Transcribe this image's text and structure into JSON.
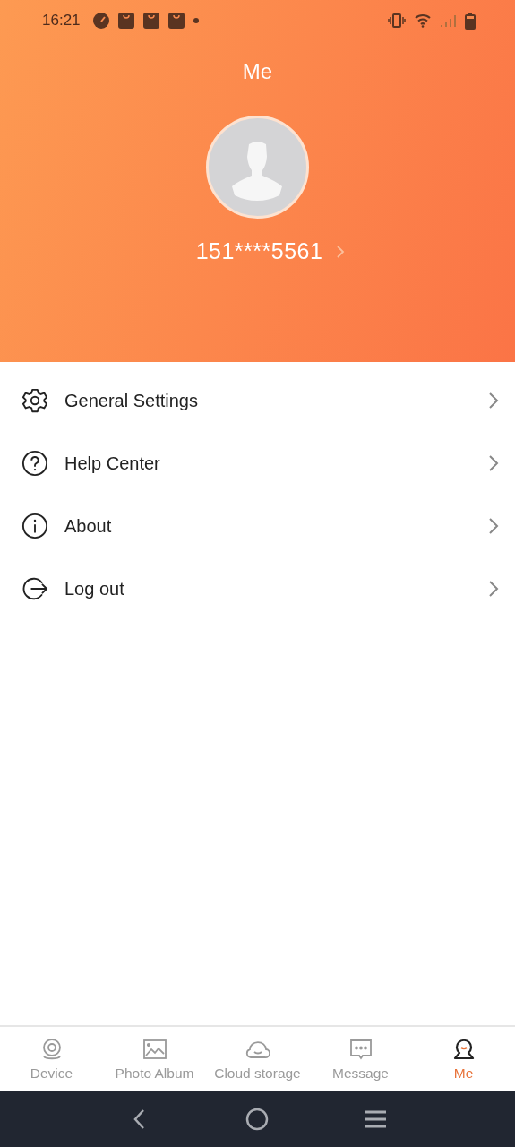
{
  "status_bar": {
    "time": "16:21"
  },
  "header": {
    "title": "Me",
    "account": "151****5561"
  },
  "menu": [
    {
      "kind": "settings",
      "label": "General Settings"
    },
    {
      "kind": "help",
      "label": "Help Center"
    },
    {
      "kind": "info",
      "label": "About"
    },
    {
      "kind": "logout",
      "label": "Log out"
    }
  ],
  "tabs": [
    {
      "kind": "device",
      "label": "Device",
      "selected": false
    },
    {
      "kind": "album",
      "label": "Photo Album",
      "selected": false
    },
    {
      "kind": "cloud",
      "label": "Cloud storage",
      "selected": false
    },
    {
      "kind": "message",
      "label": "Message",
      "selected": false
    },
    {
      "kind": "me",
      "label": "Me",
      "selected": true
    }
  ]
}
